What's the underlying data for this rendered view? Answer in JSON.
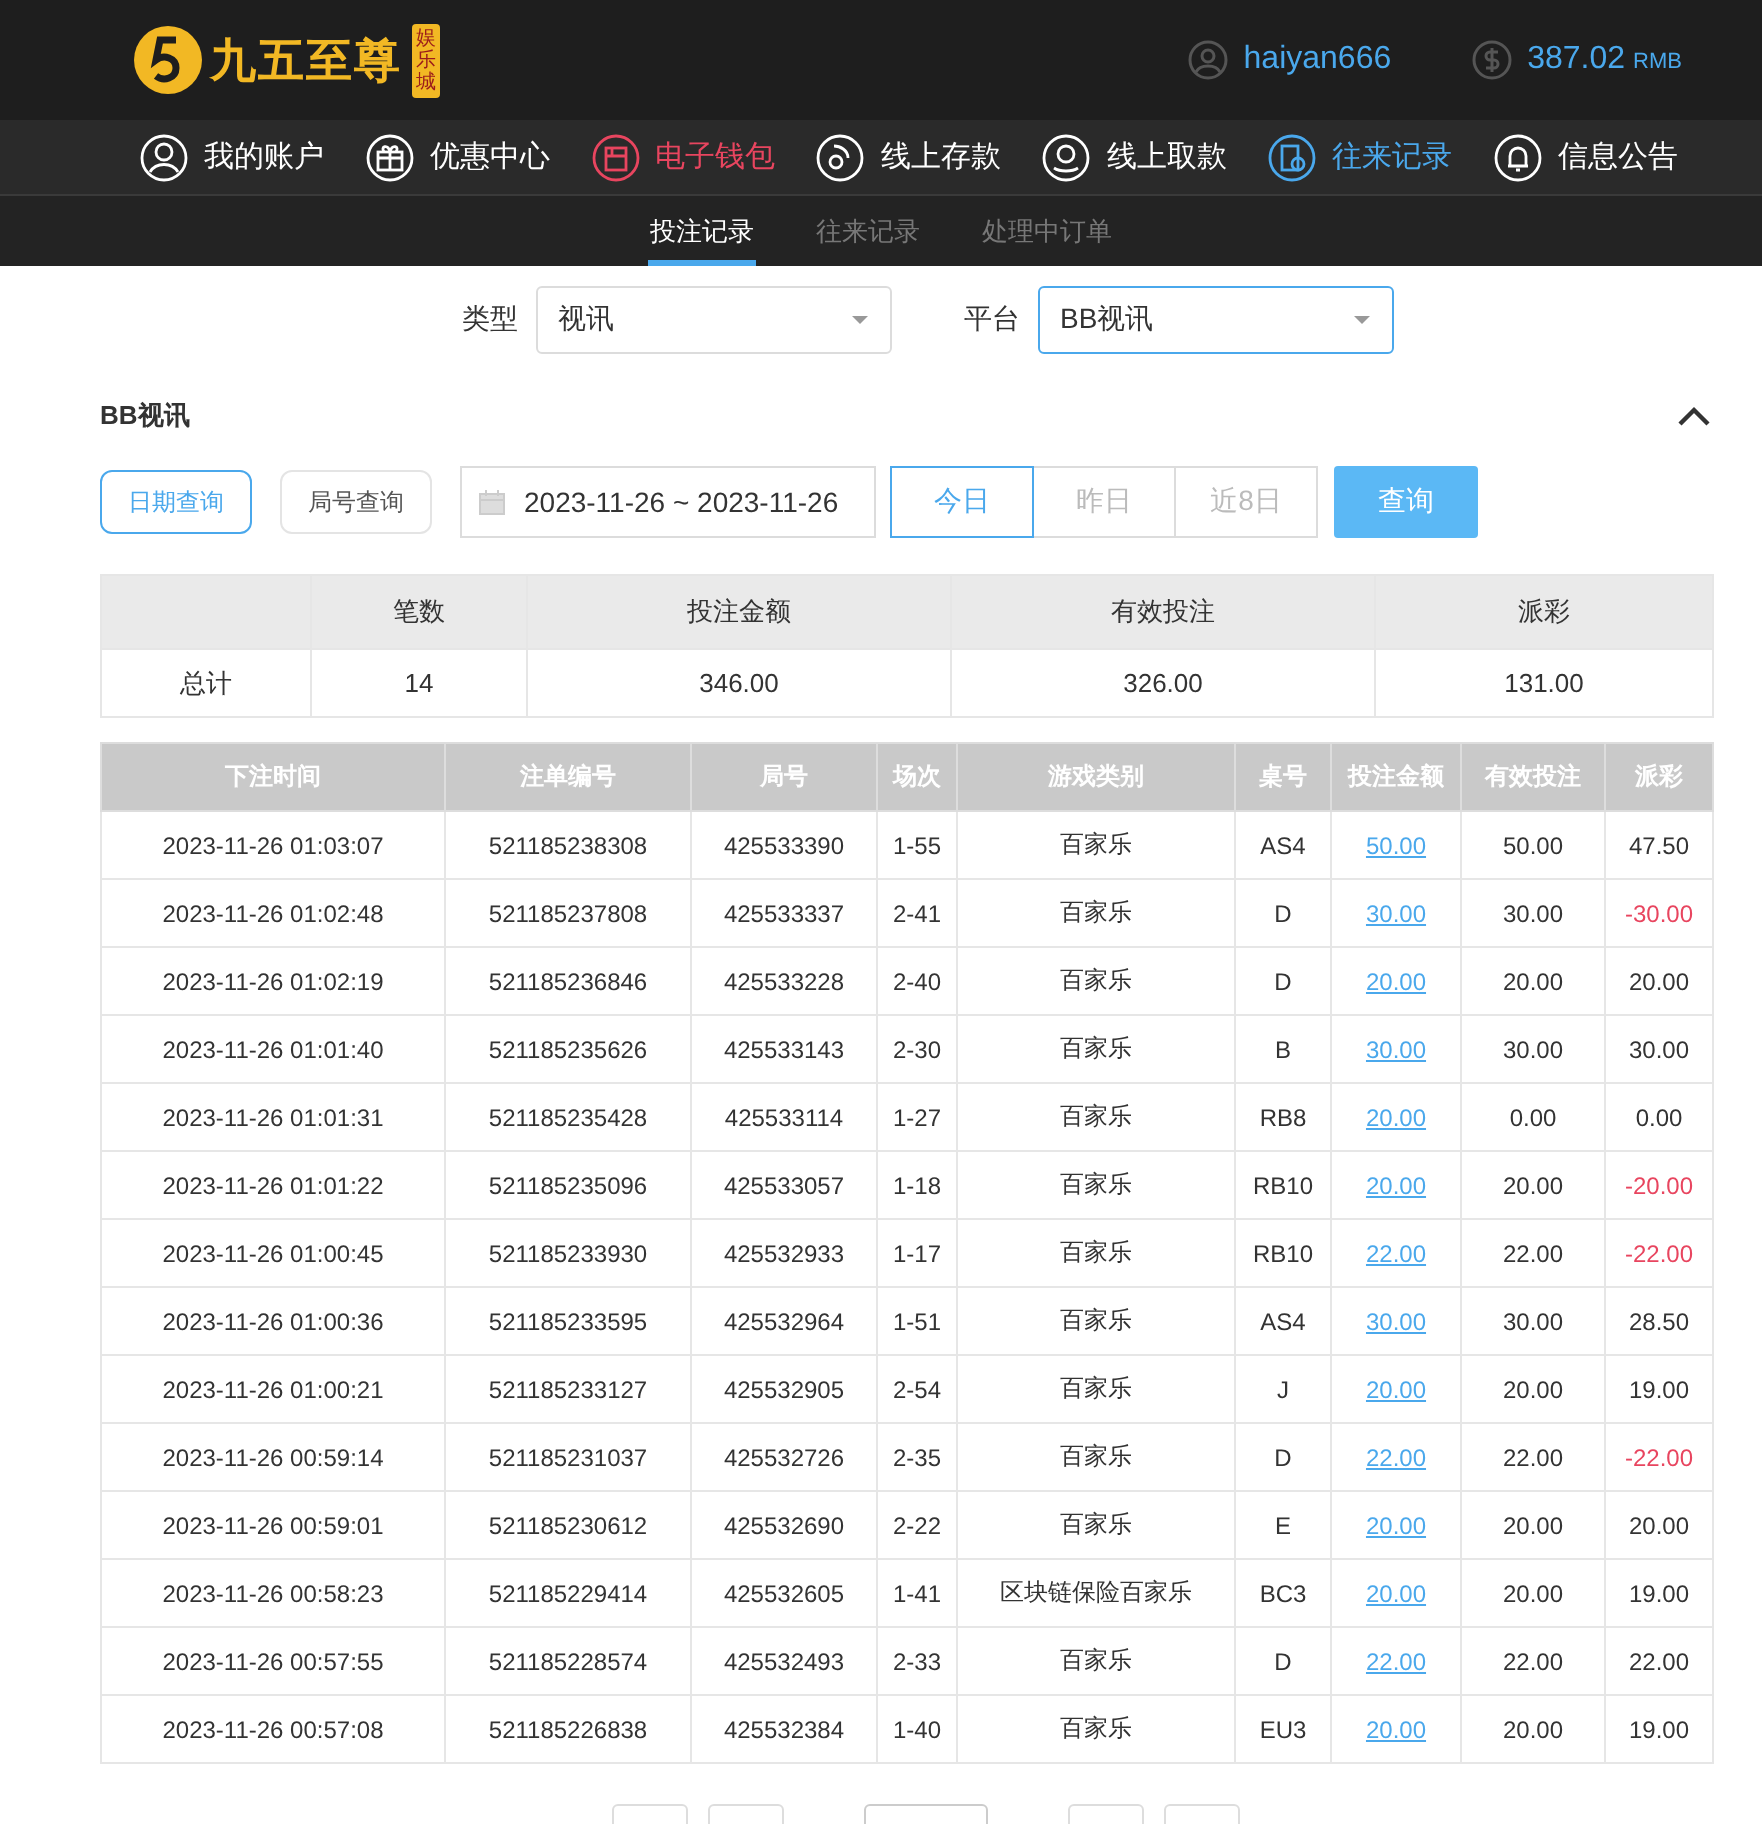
{
  "header": {
    "logo_text": "九五至尊",
    "logo_badge": "娱乐城",
    "username": "haiyan666",
    "balance": "387.02",
    "currency": "RMB"
  },
  "nav": [
    {
      "label": "我的账户",
      "color": "#ffffff"
    },
    {
      "label": "优惠中心",
      "color": "#ffffff"
    },
    {
      "label": "电子钱包",
      "color": "#e8455f"
    },
    {
      "label": "线上存款",
      "color": "#ffffff"
    },
    {
      "label": "线上取款",
      "color": "#ffffff"
    },
    {
      "label": "往来记录",
      "color": "#4aa8ec"
    },
    {
      "label": "信息公告",
      "color": "#ffffff"
    }
  ],
  "subtabs": [
    {
      "label": "投注记录",
      "selected": true
    },
    {
      "label": "往来记录",
      "selected": false
    },
    {
      "label": "处理中订单",
      "selected": false
    }
  ],
  "filters": [
    {
      "label": "类型",
      "value": "视讯",
      "focused": false
    },
    {
      "label": "平台",
      "value": "BB视讯",
      "focused": true
    }
  ],
  "section_title": "BB视讯",
  "query_modes": [
    {
      "label": "日期查询",
      "selected": true
    },
    {
      "label": "局号查询",
      "selected": false
    }
  ],
  "date_range": "2023-11-26 ~ 2023-11-26",
  "quick_ranges": [
    {
      "label": "今日",
      "selected": true
    },
    {
      "label": "昨日",
      "selected": false
    },
    {
      "label": "近8日",
      "selected": false
    }
  ],
  "search_button": "查询",
  "summary": {
    "columns": [
      "笔数",
      "投注金额",
      "有效投注",
      "派彩"
    ],
    "row_label": "总计",
    "values": [
      "14",
      "346.00",
      "326.00",
      "131.00"
    ]
  },
  "table": {
    "columns": [
      "下注时间",
      "注单编号",
      "局号",
      "场次",
      "游戏类别",
      "桌号",
      "投注金额",
      "有效投注",
      "派彩"
    ],
    "rows": [
      {
        "cells": [
          "2023-11-26 01:03:07",
          "521185238308",
          "425533390",
          "1-55",
          "百家乐",
          "AS4",
          "50.00",
          "50.00",
          "47.50"
        ],
        "loss": false
      },
      {
        "cells": [
          "2023-11-26 01:02:48",
          "521185237808",
          "425533337",
          "2-41",
          "百家乐",
          "D",
          "30.00",
          "30.00",
          "-30.00"
        ],
        "loss": true
      },
      {
        "cells": [
          "2023-11-26 01:02:19",
          "521185236846",
          "425533228",
          "2-40",
          "百家乐",
          "D",
          "20.00",
          "20.00",
          "20.00"
        ],
        "loss": false
      },
      {
        "cells": [
          "2023-11-26 01:01:40",
          "521185235626",
          "425533143",
          "2-30",
          "百家乐",
          "B",
          "30.00",
          "30.00",
          "30.00"
        ],
        "loss": false
      },
      {
        "cells": [
          "2023-11-26 01:01:31",
          "521185235428",
          "425533114",
          "1-27",
          "百家乐",
          "RB8",
          "20.00",
          "0.00",
          "0.00"
        ],
        "loss": false
      },
      {
        "cells": [
          "2023-11-26 01:01:22",
          "521185235096",
          "425533057",
          "1-18",
          "百家乐",
          "RB10",
          "20.00",
          "20.00",
          "-20.00"
        ],
        "loss": true
      },
      {
        "cells": [
          "2023-11-26 01:00:45",
          "521185233930",
          "425532933",
          "1-17",
          "百家乐",
          "RB10",
          "22.00",
          "22.00",
          "-22.00"
        ],
        "loss": true
      },
      {
        "cells": [
          "2023-11-26 01:00:36",
          "521185233595",
          "425532964",
          "1-51",
          "百家乐",
          "AS4",
          "30.00",
          "30.00",
          "28.50"
        ],
        "loss": false
      },
      {
        "cells": [
          "2023-11-26 01:00:21",
          "521185233127",
          "425532905",
          "2-54",
          "百家乐",
          "J",
          "20.00",
          "20.00",
          "19.00"
        ],
        "loss": false
      },
      {
        "cells": [
          "2023-11-26 00:59:14",
          "521185231037",
          "425532726",
          "2-35",
          "百家乐",
          "D",
          "22.00",
          "22.00",
          "-22.00"
        ],
        "loss": true
      },
      {
        "cells": [
          "2023-11-26 00:59:01",
          "521185230612",
          "425532690",
          "2-22",
          "百家乐",
          "E",
          "20.00",
          "20.00",
          "20.00"
        ],
        "loss": false
      },
      {
        "cells": [
          "2023-11-26 00:58:23",
          "521185229414",
          "425532605",
          "1-41",
          "区块链保险百家乐",
          "BC3",
          "20.00",
          "20.00",
          "19.00"
        ],
        "loss": false
      },
      {
        "cells": [
          "2023-11-26 00:57:55",
          "521185228574",
          "425532493",
          "2-33",
          "百家乐",
          "D",
          "22.00",
          "22.00",
          "22.00"
        ],
        "loss": false
      },
      {
        "cells": [
          "2023-11-26 00:57:08",
          "521185226838",
          "425532384",
          "1-40",
          "百家乐",
          "EU3",
          "20.00",
          "20.00",
          "19.00"
        ],
        "loss": false
      }
    ]
  },
  "pagination": [
    {
      "kind": "button"
    },
    {
      "kind": "button"
    },
    {
      "kind": "field"
    },
    {
      "kind": "button"
    },
    {
      "kind": "button"
    }
  ]
}
